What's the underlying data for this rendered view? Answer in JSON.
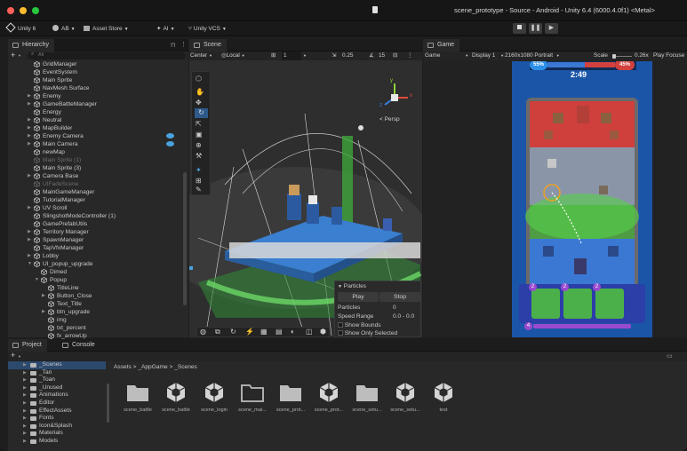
{
  "window": {
    "title": "scene_prototype - Source - Android - Unity 6.4 (6000.4.0f1) <Metal>"
  },
  "toolbar": {
    "unity_label": "Unity 6",
    "account_label": "AB",
    "asset_store_label": "Asset Store",
    "ai_label": "AI",
    "vcs_label": "Unity VCS"
  },
  "hierarchy": {
    "tab_label": "Hierarchy",
    "search_placeholder": "All",
    "items": [
      {
        "label": "GridManager",
        "depth": 0,
        "arrow": false
      },
      {
        "label": "EventSystem",
        "depth": 0,
        "arrow": false
      },
      {
        "label": "Main Sprite",
        "depth": 0,
        "arrow": false
      },
      {
        "label": "NavMesh Surface",
        "depth": 0,
        "arrow": false
      },
      {
        "label": "Enemy",
        "depth": 0,
        "arrow": true
      },
      {
        "label": "GameBattleManager",
        "depth": 0,
        "arrow": true
      },
      {
        "label": "Energy",
        "depth": 0,
        "arrow": false
      },
      {
        "label": "Neutral",
        "depth": 0,
        "arrow": true
      },
      {
        "label": "MapBuilder",
        "depth": 0,
        "arrow": true
      },
      {
        "label": "Enemy Camera",
        "depth": 0,
        "arrow": true,
        "eye": true
      },
      {
        "label": "Main Camera",
        "depth": 0,
        "arrow": true,
        "eye": true
      },
      {
        "label": "newMap",
        "depth": 0,
        "arrow": false
      },
      {
        "label": "Main Sprite (1)",
        "depth": 0,
        "arrow": false,
        "dim": true
      },
      {
        "label": "Main Sprite (3)",
        "depth": 0,
        "arrow": false
      },
      {
        "label": "Camera Base",
        "depth": 0,
        "arrow": true
      },
      {
        "label": "UIFadeScene",
        "depth": 0,
        "arrow": false,
        "dim": true
      },
      {
        "label": "MainGameManager",
        "depth": 0,
        "arrow": false
      },
      {
        "label": "TutorialManager",
        "depth": 0,
        "arrow": false
      },
      {
        "label": "UV Scroll",
        "depth": 0,
        "arrow": true
      },
      {
        "label": "SlingshotModeController (1)",
        "depth": 0,
        "arrow": false
      },
      {
        "label": "GamePrefabUtils",
        "depth": 0,
        "arrow": false
      },
      {
        "label": "Territory Manager",
        "depth": 0,
        "arrow": true
      },
      {
        "label": "SpawnManager",
        "depth": 0,
        "arrow": true
      },
      {
        "label": "TapVfxManager",
        "depth": 0,
        "arrow": false
      },
      {
        "label": "Lobby",
        "depth": 0,
        "arrow": true
      },
      {
        "label": "UI_popup_upgrade",
        "depth": 0,
        "arrow": true,
        "open": true
      },
      {
        "label": "Dimed",
        "depth": 1,
        "arrow": false
      },
      {
        "label": "Popup",
        "depth": 1,
        "arrow": true,
        "open": true
      },
      {
        "label": "TitleLine",
        "depth": 2,
        "arrow": false
      },
      {
        "label": "Button_Close",
        "depth": 2,
        "arrow": true
      },
      {
        "label": "Text_Title",
        "depth": 2,
        "arrow": false
      },
      {
        "label": "btn_upgrade",
        "depth": 2,
        "arrow": true
      },
      {
        "label": "img",
        "depth": 2,
        "arrow": false
      },
      {
        "label": "txt_percent",
        "depth": 2,
        "arrow": false
      },
      {
        "label": "fx_arrowUp",
        "depth": 2,
        "arrow": false
      }
    ]
  },
  "scene": {
    "tab_label": "Scene",
    "pivot_label": "Center",
    "space_label": "Local",
    "grid_value": "1",
    "snap_value": "0.25",
    "angle_value": "15",
    "gizmo_label": "< Persp",
    "gizmo_axes": {
      "y": "y",
      "x": "x",
      "z": "z"
    },
    "particles": {
      "header": "Particles",
      "play_label": "Play",
      "stop_label": "Stop",
      "rows": [
        {
          "label": "Particles",
          "value": "0"
        },
        {
          "label": "Speed Range",
          "value": "0.0 - 0.0"
        }
      ],
      "show_bounds_label": "Show Bounds",
      "show_only_selected_label": "Show Only Selected"
    }
  },
  "game": {
    "tab_label": "Game",
    "mode_label": "Game",
    "display_label": "Display 1",
    "resolution_label": "2160x1080 Portrait",
    "scale_label": "Scale",
    "scale_value": "0.26x",
    "play_focused_label": "Play Focuse",
    "hud": {
      "left_percent": "55%",
      "right_percent": "45%",
      "timer": "2:49",
      "card_costs": [
        "2",
        "2",
        "2"
      ],
      "next_cost": "4"
    }
  },
  "project": {
    "tab_label": "Project",
    "console_tab_label": "Console",
    "breadcrumb": [
      "Assets",
      "_AppGame",
      "_Scenes"
    ],
    "folders": [
      "_Scenes",
      "_Tan",
      "_Toan",
      "_Unused",
      "Animations",
      "Editor",
      "EffectAssets",
      "Fonts",
      "Icon&Splash",
      "Materials",
      "Models"
    ],
    "assets": [
      {
        "label": "scene_battle",
        "type": "folder"
      },
      {
        "label": "scene_battle",
        "type": "unity"
      },
      {
        "label": "scene_login",
        "type": "unity"
      },
      {
        "label": "scene_mai...",
        "type": "folder-open"
      },
      {
        "label": "scene_prot...",
        "type": "folder"
      },
      {
        "label": "scene_prot...",
        "type": "unity"
      },
      {
        "label": "scene_setu...",
        "type": "folder"
      },
      {
        "label": "scene_setu...",
        "type": "unity"
      },
      {
        "label": "test",
        "type": "unity"
      }
    ]
  },
  "colors": {
    "accent_blue": "#4aa3e0",
    "team_red": "#d2413e",
    "team_blue": "#3a78d4",
    "field_green": "#3fae3a"
  }
}
